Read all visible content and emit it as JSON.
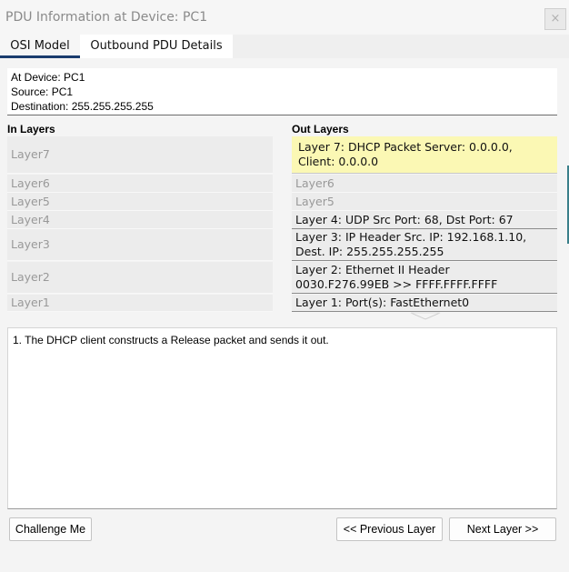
{
  "window": {
    "title": "PDU Information at Device: PC1",
    "close_label": "×"
  },
  "tabs": [
    {
      "label": "OSI Model",
      "selected": true
    },
    {
      "label": "Outbound PDU Details",
      "selected": false
    }
  ],
  "device_info": {
    "at_device": "At Device: PC1",
    "source": "Source: PC1",
    "destination": "Destination: 255.255.255.255"
  },
  "in_layers": {
    "header": "In Layers",
    "items": [
      {
        "label": "Layer7"
      },
      {
        "label": "Layer6"
      },
      {
        "label": "Layer5"
      },
      {
        "label": "Layer4"
      },
      {
        "label": "Layer3"
      },
      {
        "label": "Layer2"
      },
      {
        "label": "Layer1"
      }
    ]
  },
  "out_layers": {
    "header": "Out Layers",
    "items": [
      {
        "line1": "Layer 7: DHCP Packet Server: 0.0.0.0,",
        "line2": "Client: 0.0.0.0",
        "selected": true
      },
      {
        "line1": "Layer6",
        "line2": ""
      },
      {
        "line1": "Layer5",
        "line2": ""
      },
      {
        "line1": "Layer 4: UDP Src Port: 68, Dst Port: 67",
        "line2": ""
      },
      {
        "line1": "Layer 3: IP Header Src. IP: 192.168.1.10,",
        "line2": "Dest. IP: 255.255.255.255"
      },
      {
        "line1": "Layer 2: Ethernet II Header",
        "line2": "0030.F276.99EB >> FFFF.FFFF.FFFF"
      },
      {
        "line1": "Layer 1: Port(s): FastEthernet0",
        "line2": ""
      }
    ]
  },
  "description": {
    "text": "1. The DHCP client constructs a Release packet and sends it out."
  },
  "buttons": {
    "challenge": "Challenge Me",
    "previous": "<< Previous Layer",
    "next": "Next Layer >>"
  },
  "colors": {
    "selected_layer_bg": "#fbf8b4",
    "tab_underline": "#1a3c6e"
  }
}
